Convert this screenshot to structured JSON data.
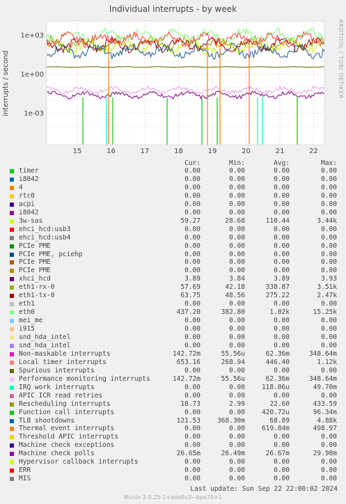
{
  "title": "Individual interrupts - by week",
  "side_text": "RRDTOOL / TOBI OETIKER",
  "chart_data": {
    "type": "line",
    "ylabel": "interrupts / second",
    "yscale": "log",
    "y_ticks": [
      "1e+03",
      "1e+00",
      "1e-03"
    ],
    "x_ticks": [
      "15",
      "16",
      "17",
      "18",
      "19",
      "20",
      "21",
      "22"
    ],
    "grid": true,
    "series_levels": [
      {
        "name": "3w-sas",
        "color": "#ccff00",
        "level": 150
      },
      {
        "name": "eth1-rx-0",
        "color": "#a0a000",
        "level": 250
      },
      {
        "name": "eth1-tx-0",
        "color": "#990000",
        "level": 200
      },
      {
        "name": "eth0",
        "color": "#80ff80",
        "level": 1000
      },
      {
        "name": "Local timer interrupts",
        "color": "#ff4040",
        "level": 500
      },
      {
        "name": "TLB shootdowns",
        "color": "#1e5a8c",
        "level": 60
      },
      {
        "name": "xhci_hcd",
        "color": "#606000",
        "level": 3.8
      },
      {
        "name": "Machine check polls",
        "color": "#7a007a",
        "level": 0.0267
      },
      {
        "name": "Performance monitoring interrupts",
        "color": "#ee99ee",
        "level": 0.0624
      }
    ]
  },
  "legend_headers": {
    "cur": "Cur:",
    "min": "Min:",
    "avg": "Avg:",
    "max": "Max:"
  },
  "legend": [
    {
      "name": "timer",
      "color": "#00cc00",
      "cur": "0.00",
      "min": "0.00",
      "avg": "0.00",
      "max": "0.00"
    },
    {
      "name": "i8042",
      "color": "#0066b3",
      "cur": "0.00",
      "min": "0.00",
      "avg": "0.00",
      "max": "0.00"
    },
    {
      "name": "4",
      "color": "#ff8000",
      "cur": "0.00",
      "min": "0.00",
      "avg": "0.00",
      "max": "0.00"
    },
    {
      "name": "rtc0",
      "color": "#ffcc00",
      "cur": "0.00",
      "min": "0.00",
      "avg": "0.00",
      "max": "0.00"
    },
    {
      "name": "acpi",
      "color": "#330099",
      "cur": "0.00",
      "min": "0.00",
      "avg": "0.00",
      "max": "0.00"
    },
    {
      "name": "i8042",
      "color": "#990099",
      "cur": "0.00",
      "min": "0.00",
      "avg": "0.00",
      "max": "0.00"
    },
    {
      "name": "3w-sas",
      "color": "#ccff00",
      "cur": "59.27",
      "min": "28.68",
      "avg": "110.44",
      "max": "3.44k"
    },
    {
      "name": "ehci_hcd:usb3",
      "color": "#ff0000",
      "cur": "0.00",
      "min": "0.00",
      "avg": "0.00",
      "max": "0.00"
    },
    {
      "name": "ehci_hcd:usb4",
      "color": "#808080",
      "cur": "0.00",
      "min": "0.00",
      "avg": "0.00",
      "max": "0.00"
    },
    {
      "name": "PCIe PME",
      "color": "#008f00",
      "cur": "0.00",
      "min": "0.00",
      "avg": "0.00",
      "max": "0.00"
    },
    {
      "name": "PCIe PME, pciehp",
      "color": "#00487d",
      "cur": "0.00",
      "min": "0.00",
      "avg": "0.00",
      "max": "0.00"
    },
    {
      "name": "PCIe PME",
      "color": "#b35a00",
      "cur": "0.00",
      "min": "0.00",
      "avg": "0.00",
      "max": "0.00"
    },
    {
      "name": "PCIe PME",
      "color": "#b38f00",
      "cur": "0.00",
      "min": "0.00",
      "avg": "0.00",
      "max": "0.00"
    },
    {
      "name": "xhci_hcd",
      "color": "#6b006b",
      "cur": "3.89",
      "min": "3.84",
      "avg": "3.89",
      "max": "3.93"
    },
    {
      "name": "eth1-rx-0",
      "color": "#8fb300",
      "cur": "57.69",
      "min": "42.18",
      "avg": "338.87",
      "max": "3.51k"
    },
    {
      "name": "eth1-tx-0",
      "color": "#b30000",
      "cur": "63.75",
      "min": "48.56",
      "avg": "275.22",
      "max": "2.47k"
    },
    {
      "name": "eth1",
      "color": "#bebebe",
      "cur": "0.00",
      "min": "0.00",
      "avg": "0.00",
      "max": "0.00"
    },
    {
      "name": "eth0",
      "color": "#80ff80",
      "cur": "437.20",
      "min": "382.80",
      "avg": "1.02k",
      "max": "15.25k"
    },
    {
      "name": "mei_me",
      "color": "#80c9ff",
      "cur": "0.00",
      "min": "0.00",
      "avg": "0.00",
      "max": "0.00"
    },
    {
      "name": "i915",
      "color": "#ffc080",
      "cur": "0.00",
      "min": "0.00",
      "avg": "0.00",
      "max": "0.00"
    },
    {
      "name": "snd_hda_intel",
      "color": "#ffe680",
      "cur": "0.00",
      "min": "0.00",
      "avg": "0.00",
      "max": "0.00"
    },
    {
      "name": "snd_hda_intel",
      "color": "#aa80ff",
      "cur": "0.00",
      "min": "0.00",
      "avg": "0.00",
      "max": "0.00"
    },
    {
      "name": "Non-maskable interrupts",
      "color": "#ee00cc",
      "cur": "142.72m",
      "min": "55.56u",
      "avg": "62.36m",
      "max": "348.64m"
    },
    {
      "name": "Local timer interrupts",
      "color": "#ff8080",
      "cur": "653.16",
      "min": "268.94",
      "avg": "446.40",
      "max": "1.12k"
    },
    {
      "name": "Spurious interrupts",
      "color": "#666600",
      "cur": "0.00",
      "min": "0.00",
      "avg": "0.00",
      "max": "0.00"
    },
    {
      "name": "Performance monitoring interrupts",
      "color": "#ffbfff",
      "cur": "142.72m",
      "min": "55.56u",
      "avg": "62.36m",
      "max": "348.64m"
    },
    {
      "name": "IRQ work interrupts",
      "color": "#00ffcc",
      "cur": "0.00",
      "min": "0.00",
      "avg": "118.06u",
      "max": "49.70m"
    },
    {
      "name": "APIC ICR read retries",
      "color": "#cc6699",
      "cur": "0.00",
      "min": "0.00",
      "avg": "0.00",
      "max": "0.00"
    },
    {
      "name": "Rescheduling interrupts",
      "color": "#999900",
      "cur": "18.73",
      "min": "2.99",
      "avg": "22.60",
      "max": "433.59"
    },
    {
      "name": "Function call interrupts",
      "color": "#00cc00",
      "cur": "0.00",
      "min": "0.00",
      "avg": "420.72u",
      "max": "96.34m"
    },
    {
      "name": "TLB shootdowns",
      "color": "#0066b3",
      "cur": "121.53",
      "min": "368.30m",
      "avg": "68.89",
      "max": "4.88k"
    },
    {
      "name": "Thermal event interrupts",
      "color": "#ff8000",
      "cur": "0.00",
      "min": "0.00",
      "avg": "619.84m",
      "max": "498.97"
    },
    {
      "name": "Threshold APIC interrupts",
      "color": "#ffcc00",
      "cur": "0.00",
      "min": "0.00",
      "avg": "0.00",
      "max": "0.00"
    },
    {
      "name": "Machine check exceptions",
      "color": "#330099",
      "cur": "0.00",
      "min": "0.00",
      "avg": "0.00",
      "max": "0.00"
    },
    {
      "name": "Machine check polls",
      "color": "#990099",
      "cur": "26.65m",
      "min": "26.49m",
      "avg": "26.67m",
      "max": "29.98m"
    },
    {
      "name": "Hypervisor callback interrupts",
      "color": "#ccff00",
      "cur": "0.00",
      "min": "0.00",
      "avg": "0.00",
      "max": "0.00"
    },
    {
      "name": "ERR",
      "color": "#ff0000",
      "cur": "0.00",
      "min": "0.00",
      "avg": "0.00",
      "max": "0.00"
    },
    {
      "name": "MIS",
      "color": "#808080",
      "cur": "0.00",
      "min": "0.00",
      "avg": "0.00",
      "max": "0.00"
    }
  ],
  "last_update": "Last update:  Sun Sep 22 22:00:02 2024",
  "version": "Munin 2.0.25-1+deb8u3~bpo70+1"
}
